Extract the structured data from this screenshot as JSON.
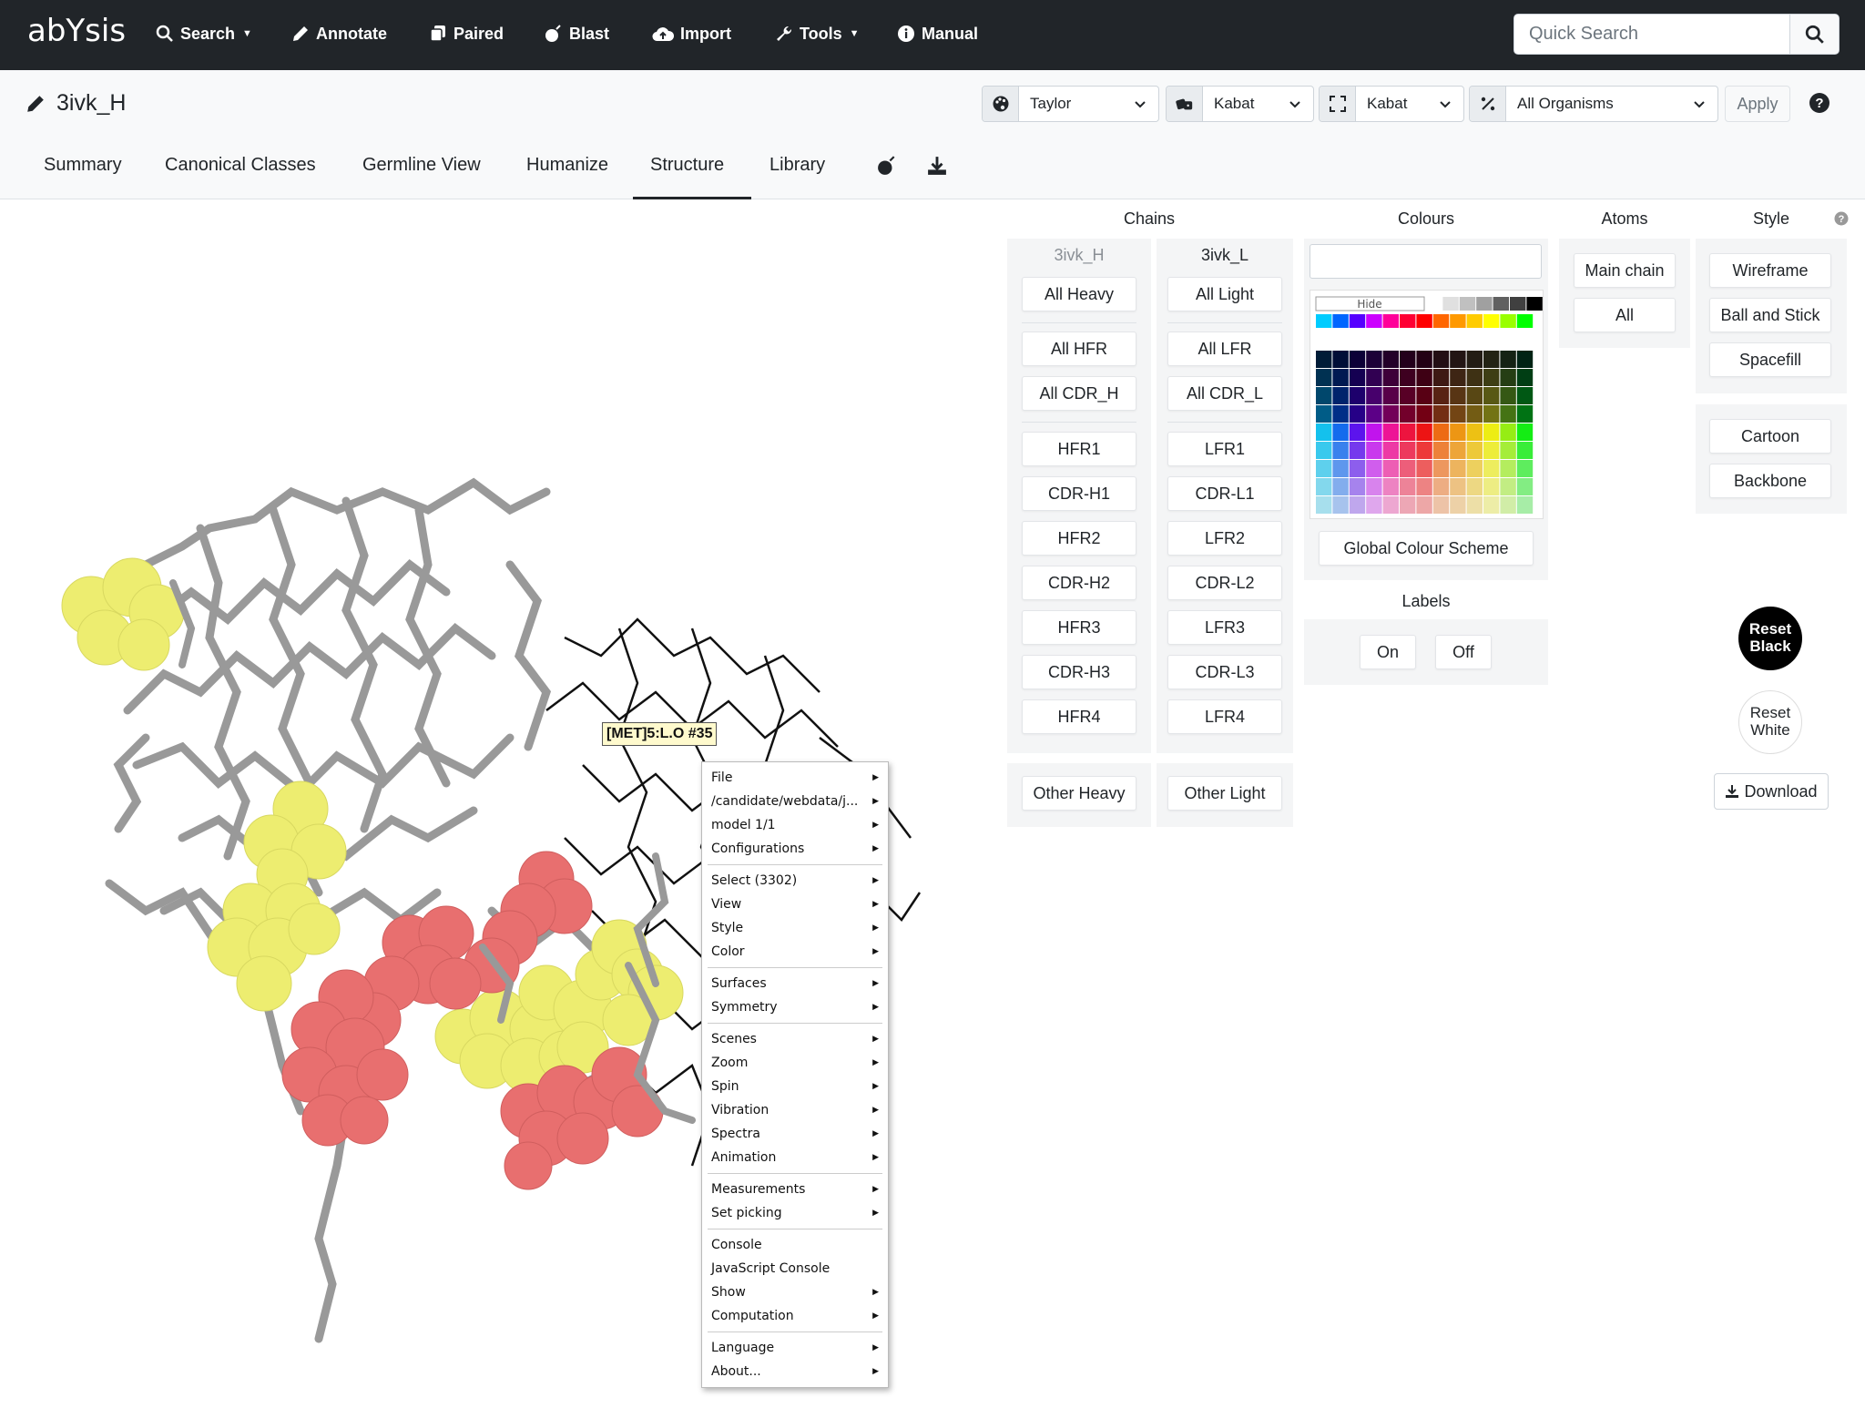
{
  "brand": {
    "logo": "abYsis"
  },
  "nav": [
    {
      "label": "Search",
      "icon": "search-icon",
      "dropdown": true
    },
    {
      "label": "Annotate",
      "icon": "pencil-icon",
      "dropdown": false
    },
    {
      "label": "Paired",
      "icon": "paired-icon",
      "dropdown": false
    },
    {
      "label": "Blast",
      "icon": "bomb-icon",
      "dropdown": false
    },
    {
      "label": "Import",
      "icon": "cloud-upload-icon",
      "dropdown": false
    },
    {
      "label": "Tools",
      "icon": "wrench-icon",
      "dropdown": true
    },
    {
      "label": "Manual",
      "icon": "info-circle-icon",
      "dropdown": false
    }
  ],
  "quick_search": {
    "placeholder": "Quick Search"
  },
  "page": {
    "title": "3ivk_H"
  },
  "selectors": {
    "colour_scheme": "Taylor",
    "numbering": "Kabat",
    "region": "Kabat",
    "organism": "All Organisms",
    "apply": "Apply"
  },
  "tabs": [
    {
      "label": "Summary",
      "active": false
    },
    {
      "label": "Canonical Classes",
      "active": false
    },
    {
      "label": "Germline View",
      "active": false
    },
    {
      "label": "Humanize",
      "active": false
    },
    {
      "label": "Structure",
      "active": true
    },
    {
      "label": "Library",
      "active": false
    }
  ],
  "viewer": {
    "pick_label": "[MET]5:L.O #35",
    "context_menu": [
      [
        {
          "label": "File",
          "sub": true
        },
        {
          "label": "/candidate/webdata/j...",
          "sub": true
        },
        {
          "label": "model 1/1",
          "sub": true
        },
        {
          "label": "Configurations",
          "sub": true
        }
      ],
      [
        {
          "label": "Select (3302)",
          "sub": true
        },
        {
          "label": "View",
          "sub": true
        },
        {
          "label": "Style",
          "sub": true
        },
        {
          "label": "Color",
          "sub": true
        }
      ],
      [
        {
          "label": "Surfaces",
          "sub": true
        },
        {
          "label": "Symmetry",
          "sub": true
        }
      ],
      [
        {
          "label": "Scenes",
          "sub": true
        },
        {
          "label": "Zoom",
          "sub": true
        },
        {
          "label": "Spin",
          "sub": true
        },
        {
          "label": "Vibration",
          "sub": true
        },
        {
          "label": "Spectra",
          "sub": true
        },
        {
          "label": "Animation",
          "sub": true
        }
      ],
      [
        {
          "label": "Measurements",
          "sub": true
        },
        {
          "label": "Set picking",
          "sub": true
        }
      ],
      [
        {
          "label": "Console",
          "sub": false
        },
        {
          "label": "JavaScript Console",
          "sub": false
        },
        {
          "label": "Show",
          "sub": true
        },
        {
          "label": "Computation",
          "sub": true
        }
      ],
      [
        {
          "label": "Language",
          "sub": true
        },
        {
          "label": "About...",
          "sub": true
        }
      ]
    ]
  },
  "panel": {
    "headers": {
      "chains": "Chains",
      "colours": "Colours",
      "atoms": "Atoms",
      "style": "Style",
      "labels": "Labels"
    },
    "heavy": {
      "name": "3ivk_H",
      "all": "All Heavy",
      "groups": [
        "All HFR",
        "All CDR_H"
      ],
      "regions": [
        "HFR1",
        "CDR-H1",
        "HFR2",
        "CDR-H2",
        "HFR3",
        "CDR-H3",
        "HFR4"
      ],
      "other": "Other Heavy"
    },
    "light": {
      "name": "3ivk_L",
      "all": "All Light",
      "groups": [
        "All LFR",
        "All CDR_L"
      ],
      "regions": [
        "LFR1",
        "CDR-L1",
        "LFR2",
        "CDR-L2",
        "LFR3",
        "CDR-L3",
        "LFR4"
      ],
      "other": "Other Light"
    },
    "palette_hide": "Hide",
    "global_scheme": "Global Colour Scheme",
    "labels_on": "On",
    "labels_off": "Off",
    "atoms": [
      "Main chain",
      "All"
    ],
    "styles": [
      "Wireframe",
      "Ball and Stick",
      "Spacefill"
    ],
    "styles2": [
      "Cartoon",
      "Backbone"
    ],
    "reset_black": "Reset Black",
    "reset_white": "Reset White",
    "download": "Download"
  },
  "palette_colors": {
    "greys": [
      "#ffffff",
      "#e0e0e0",
      "#c0c0c0",
      "#a0a0a0",
      "#606060",
      "#404040",
      "#000000"
    ],
    "brights": [
      "#00ccff",
      "#0066ff",
      "#5500ff",
      "#cc00ff",
      "#ff0099",
      "#ff0033",
      "#ff0000",
      "#ff6600",
      "#ff9900",
      "#ffcc00",
      "#ffff00",
      "#99ff00",
      "#00ff00"
    ],
    "hues": [
      "#0a3a5a",
      "#1a2a6a",
      "#2a1a6a",
      "#4a1a6a",
      "#5a1a4a",
      "#6a1a2a",
      "#6a1a1a",
      "#6a2a0a",
      "#6a4a0a",
      "#6a5a0a",
      "#6a6a0a",
      "#4a6a0a",
      "#2a5a1a"
    ]
  }
}
